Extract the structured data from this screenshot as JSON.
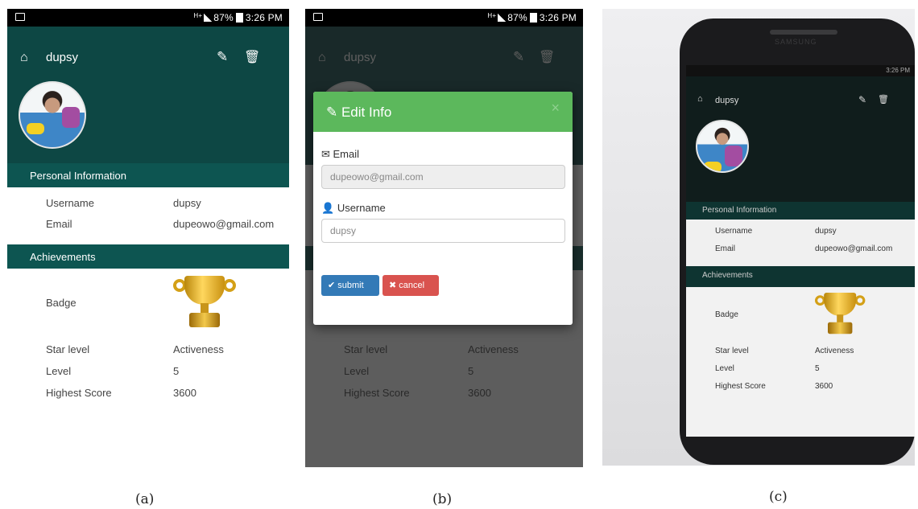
{
  "screen": {
    "status_time": "3:26 PM",
    "status_battery": "87%",
    "status_network": "H+",
    "title": "dupsy",
    "personal_info_header": "Personal Information",
    "username_label": "Username",
    "username_value": "dupsy",
    "email_label": "Email",
    "email_value": "dupeowo@gmail.com",
    "achievements_header": "Achievements",
    "badge_label": "Badge",
    "star_label": "Star level",
    "star_value": "Activeness",
    "level_label": "Level",
    "level_value": "5",
    "score_label": "Highest Score",
    "score_value": "3600"
  },
  "modal": {
    "title": "Edit Info",
    "close": "×",
    "email_label": "Email",
    "email_value": "dupeowo@gmail.com",
    "username_label": "Username",
    "username_value": "dupsy",
    "submit": "submit",
    "cancel": "cancel"
  },
  "photo": {
    "brand": "SAMSUNG",
    "star_value": "Activeness"
  },
  "captions": {
    "a": "(a)",
    "b": "(b)",
    "c": "(c)"
  },
  "colors": {
    "appbar": "#0d4744",
    "section": "#0d5551",
    "modal_header": "#5cb85c",
    "submit": "#337ab7",
    "cancel": "#d9534f"
  },
  "icons": [
    "home-icon",
    "edit-icon",
    "trash-icon",
    "envelope-icon",
    "user-icon",
    "check-icon",
    "times-icon",
    "trophy-icon"
  ]
}
